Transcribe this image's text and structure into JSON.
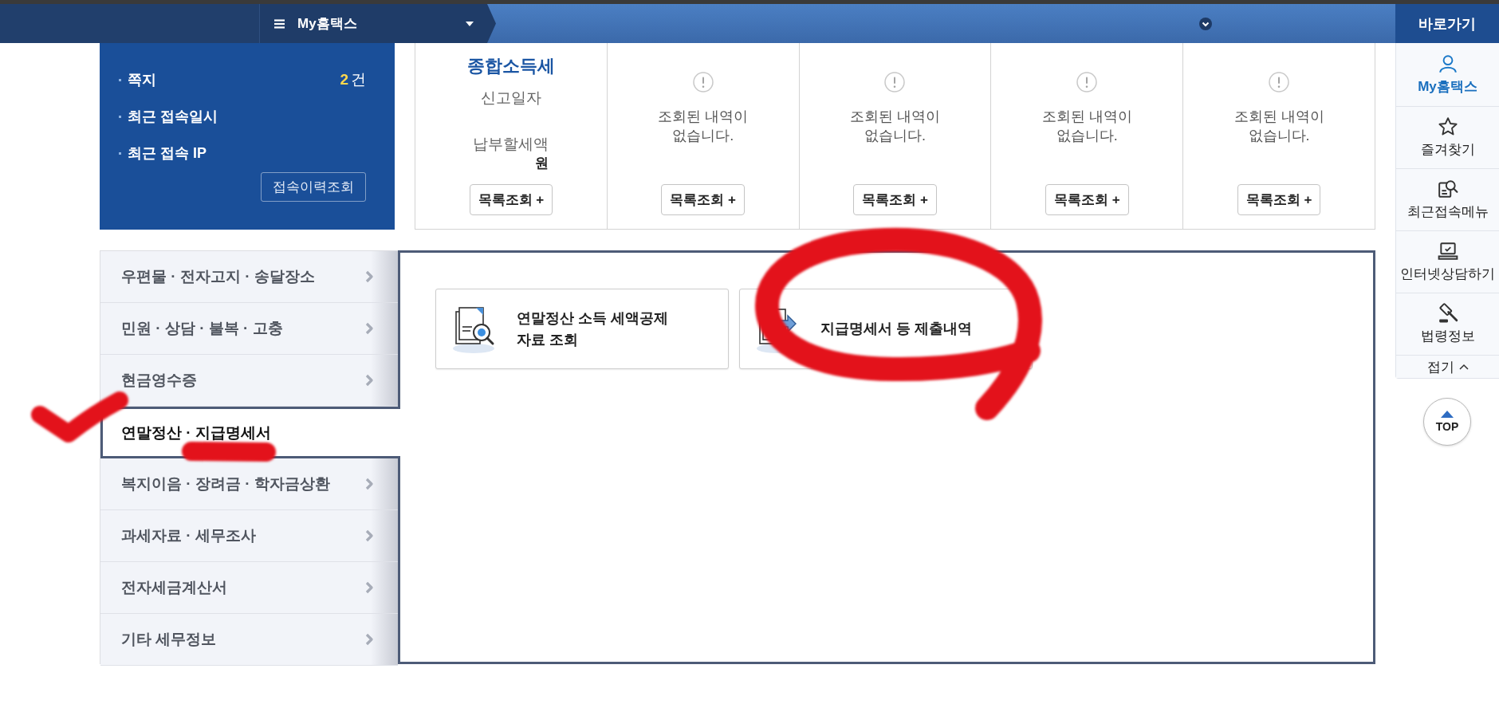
{
  "top_nav": {
    "menu_label": "My홈택스"
  },
  "user_panel": {
    "items": [
      {
        "kind": "count",
        "label": "쪽지",
        "count": "2",
        "unit": "건"
      },
      {
        "kind": "plain",
        "label": "최근 접속일시"
      },
      {
        "kind": "plain",
        "label": "최근 접속 IP"
      }
    ],
    "button": "접속이력조회"
  },
  "tax_cards": [
    {
      "kind": "summary",
      "title": "종합소득세",
      "fields": [
        {
          "label": "신고일자"
        },
        {
          "label": "납부할세액",
          "value": "원"
        }
      ],
      "button": "목록조회 +"
    },
    {
      "kind": "empty",
      "message": "조회된 내역이\n없습니다.",
      "button": "목록조회 +"
    },
    {
      "kind": "empty",
      "message": "조회된 내역이\n없습니다.",
      "button": "목록조회 +"
    },
    {
      "kind": "empty",
      "message": "조회된 내역이\n없습니다.",
      "button": "목록조회 +"
    },
    {
      "kind": "empty",
      "message": "조회된 내역이\n없습니다.",
      "button": "목록조회 +"
    }
  ],
  "menu": {
    "items": [
      {
        "label": "우편물 · 전자고지 · 송달장소",
        "selected": false
      },
      {
        "label": "민원 · 상담 · 불복 · 고충",
        "selected": false
      },
      {
        "label": "현금영수증",
        "selected": false
      },
      {
        "label": "연말정산 · 지급명세서",
        "selected": true
      },
      {
        "label": "복지이음 · 장려금 · 학자금상환",
        "selected": false
      },
      {
        "label": "과세자료 · 세무조사",
        "selected": false
      },
      {
        "label": "전자세금계산서",
        "selected": false
      },
      {
        "label": "기타 세무정보",
        "selected": false
      }
    ]
  },
  "content": {
    "cards": [
      {
        "label": "연말정산 소득 세액공제\n자료 조회"
      },
      {
        "label": "지급명세서 등 제출내역"
      }
    ]
  },
  "quick_menu": {
    "title": "바로가기",
    "items": [
      {
        "label": "My홈택스",
        "selected": true
      },
      {
        "label": "즐겨찾기",
        "selected": false
      },
      {
        "label": "최근접속메뉴",
        "selected": false
      },
      {
        "label": "인터넷상담하기",
        "selected": false
      },
      {
        "label": "법령정보",
        "selected": false
      }
    ],
    "collapse": "접기",
    "top": "TOP"
  },
  "annotations": [
    {
      "kind": "loop"
    },
    {
      "kind": "check"
    },
    {
      "kind": "underline"
    }
  ]
}
